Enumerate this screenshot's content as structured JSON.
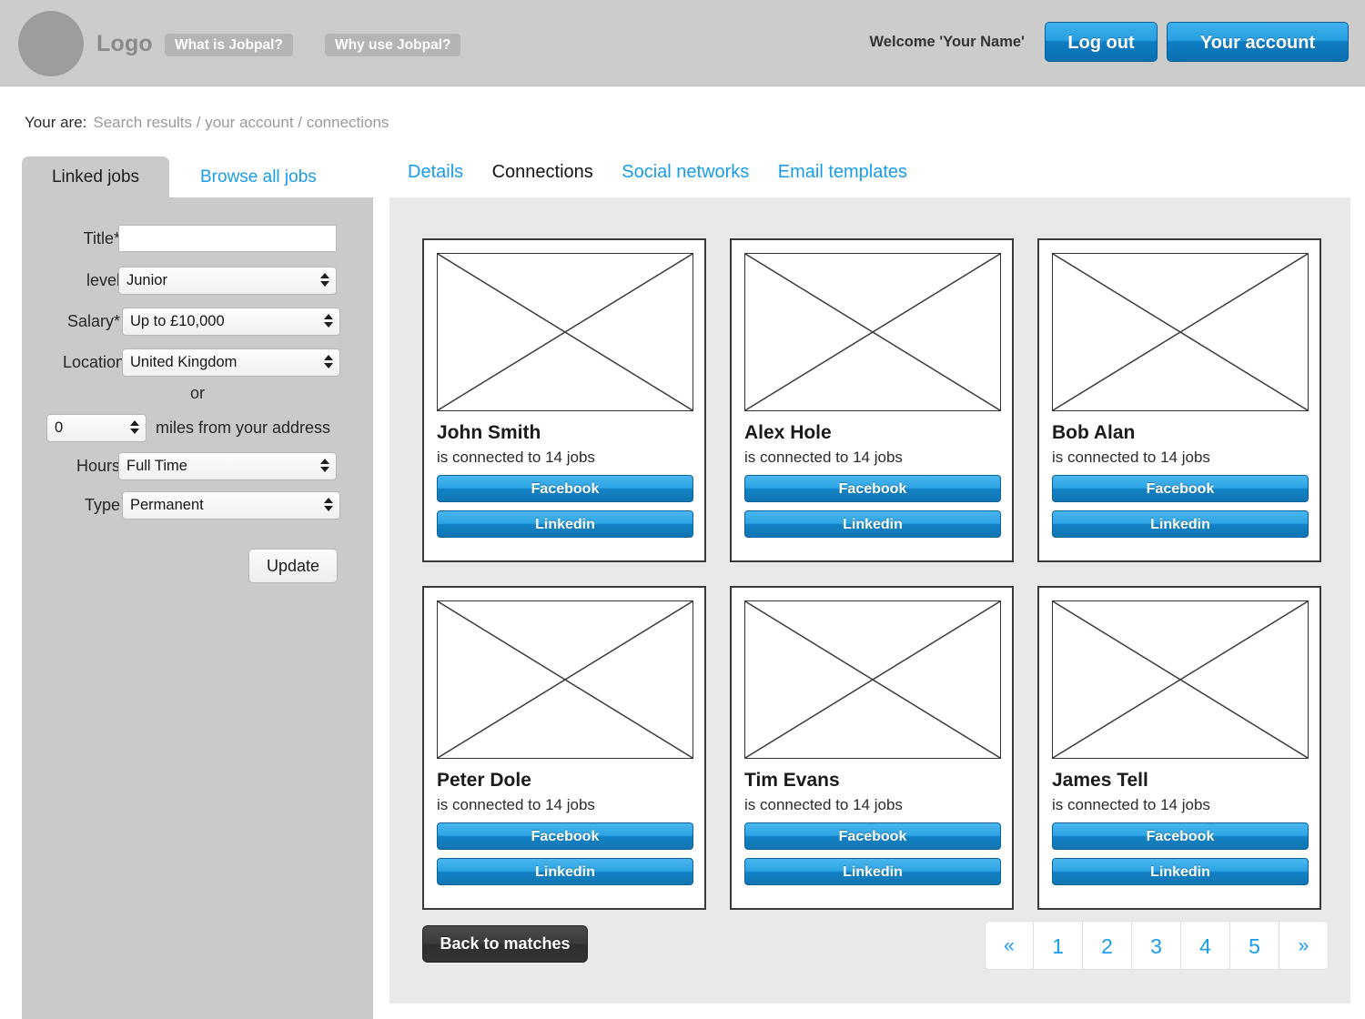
{
  "header": {
    "logo_text": "Logo",
    "nav": [
      {
        "label": "What is Jobpal?"
      },
      {
        "label": "Why use Jobpal?"
      }
    ],
    "welcome": "Welcome 'Your Name'",
    "logout_label": "Log out",
    "account_label": "Your account",
    "bg_color": "#cccccc",
    "accent_color": "#1a9cec"
  },
  "breadcrumb": {
    "label": "Your are:",
    "path": "Search results / your account / connections"
  },
  "left_tabs": [
    {
      "label": "Linked jobs",
      "active": true
    },
    {
      "label": "Browse all jobs",
      "active": false
    }
  ],
  "right_tabs": [
    {
      "label": "Details",
      "active": false
    },
    {
      "label": "Connections",
      "active": true
    },
    {
      "label": "Social networks",
      "active": false
    },
    {
      "label": "Email templates",
      "active": false
    }
  ],
  "sidebar": {
    "fields": {
      "title": {
        "label": "Title*",
        "value": "",
        "placeholder": ""
      },
      "level": {
        "label": "level",
        "value": "Junior"
      },
      "salary": {
        "label": "Salary*",
        "value": "Up to £10,000"
      },
      "location": {
        "label": "Location",
        "value": "United Kingdom"
      },
      "or": "or",
      "miles": {
        "value": "0",
        "text": "miles from your address"
      },
      "hours": {
        "label": "Hours",
        "value": "Full Time"
      },
      "type": {
        "label": "Type",
        "value": "Permanent"
      }
    },
    "update_label": "Update"
  },
  "connections": [
    {
      "name": "John Smith",
      "subtitle": "is connected to 14 jobs",
      "facebook": "Facebook",
      "linkedin": "Linkedin"
    },
    {
      "name": "Alex Hole",
      "subtitle": "is connected to 14 jobs",
      "facebook": "Facebook",
      "linkedin": "Linkedin"
    },
    {
      "name": "Bob Alan",
      "subtitle": "is connected to 14 jobs",
      "facebook": "Facebook",
      "linkedin": "Linkedin"
    },
    {
      "name": "Peter Dole",
      "subtitle": "is connected to 14 jobs",
      "facebook": "Facebook",
      "linkedin": "Linkedin"
    },
    {
      "name": "Tim Evans",
      "subtitle": "is connected to 14 jobs",
      "facebook": "Facebook",
      "linkedin": "Linkedin"
    },
    {
      "name": "James Tell",
      "subtitle": "is connected to 14 jobs",
      "facebook": "Facebook",
      "linkedin": "Linkedin"
    }
  ],
  "footer": {
    "back_label": "Back to matches",
    "pagination": [
      "«",
      "1",
      "2",
      "3",
      "4",
      "5",
      "»"
    ]
  }
}
